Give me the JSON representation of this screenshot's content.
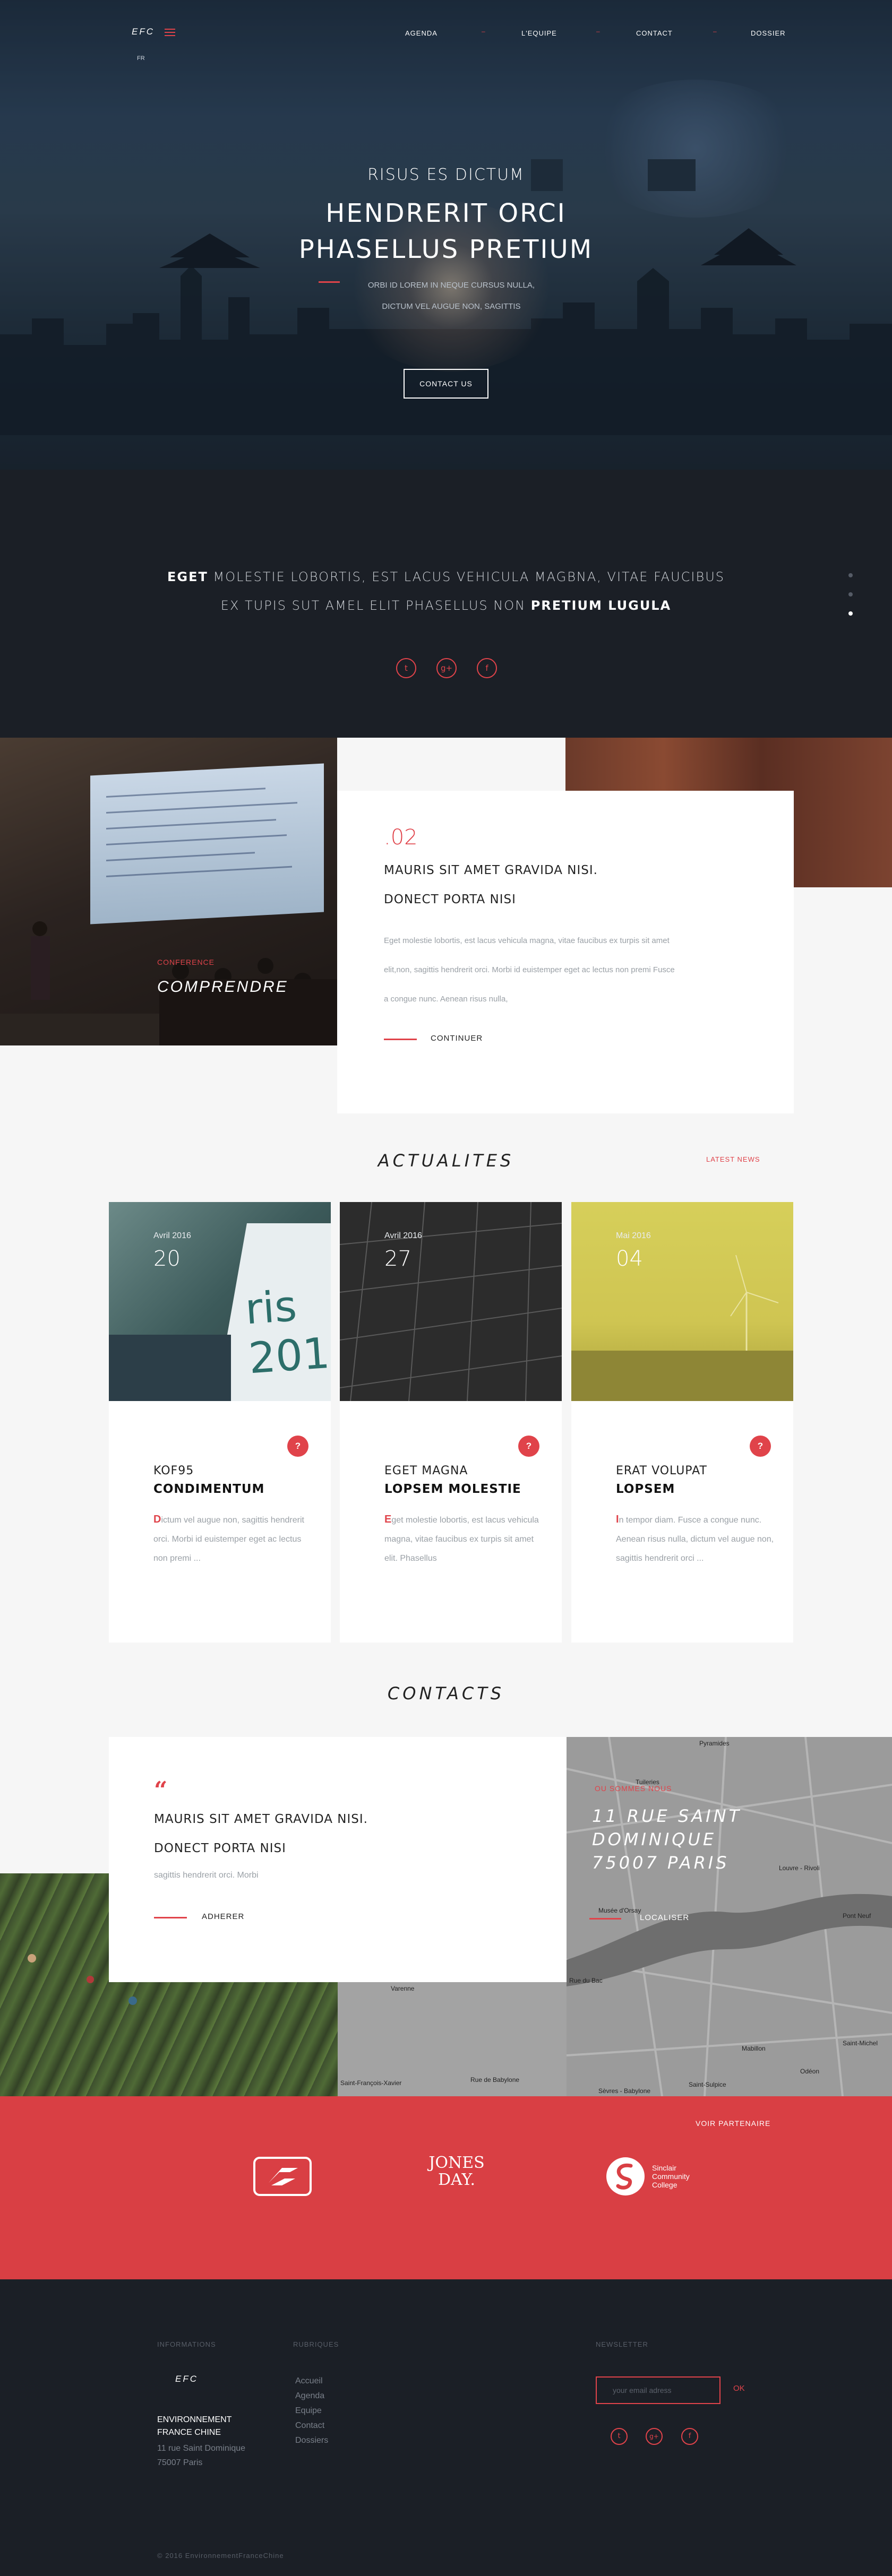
{
  "header": {
    "brand": "EFC",
    "lang": "FR",
    "nav": [
      "AGENDA",
      "L'EQUIPE",
      "CONTACT",
      "DOSSIER"
    ],
    "nav_sep": "–"
  },
  "hero": {
    "kicker": "RISUS ES DICTUM",
    "title_line1": "HENDRERIT ORCI",
    "title_line2": "PHASELLUS PRETIUM",
    "sub_line1": "ORBI ID LOREM IN NEQUE CURSUS NULLA,",
    "sub_line2": "DICTUM VEL AUGUE NON, SAGITTIS",
    "button": "CONTACT US"
  },
  "intro": {
    "line1_bold": "EGET",
    "line1_rest": " MOLESTIE LOBORTIS, EST LACUS VEHICULA MAGBNA, VITAE FAUCIBUS",
    "line2_rest": "EX TUPIS SUT AMEL ELIT PHASELLUS NON ",
    "line2_bold": "PRETIUM LUGULA",
    "social": [
      "twitter-icon",
      "google-plus-icon",
      "facebook-icon"
    ],
    "social_glyphs": [
      "t",
      "g+",
      "f"
    ]
  },
  "conference": {
    "label": "CONFERENCE",
    "title": "COMPRENDRE",
    "number": ".02",
    "heading1": "MAURIS SIT AMET GRAVIDA NISI.",
    "heading2": "DONECT PORTA NISI",
    "text_line1": "Eget molestie lobortis, est lacus vehicula magna, vitae faucibus ex turpis sit amet",
    "text_line2": "elit,non, sagittis hendrerit orci. Morbi id euistemper eget ac lectus non premi Fusce",
    "text_line3": "a congue nunc. Aenean risus nulla,",
    "link": "CONTINUER"
  },
  "news": {
    "title": "ACTUALITES",
    "latest": "LATEST NEWS",
    "items": [
      {
        "month": "Avril 2016",
        "day": "20",
        "badge": "?",
        "title1": "KOF95",
        "title2": "CONDIMENTUM",
        "initial": "D",
        "text": "ictum vel augue non, sagittis hendrerit orci. Morbi id euistemper eget ac lectus non premi ..."
      },
      {
        "month": "Avril 2016",
        "day": "27",
        "badge": "?",
        "title1": "EGET MAGNA",
        "title2": "LOPSEM MOLESTIE",
        "initial": "E",
        "text": "get molestie lobortis, est lacus vehicula magna, vitae faucibus ex turpis sit amet elit. Phasellus"
      },
      {
        "month": "Mai 2016",
        "day": "04",
        "badge": "?",
        "title1": "ERAT VOLUPAT",
        "title2": "LOPSEM",
        "initial": "I",
        "text": "n tempor diam. Fusce a congue nunc. Aenean risus nulla, dictum vel augue non, sagittis hendrerit orci ..."
      }
    ]
  },
  "contacts": {
    "title": "CONTACTS",
    "quote": "“",
    "heading1": "MAURIS SIT AMET GRAVIDA NISI.",
    "heading2": "DONECT PORTA NISI",
    "text": "sagittis hendrerit orci. Morbi",
    "link": "ADHERER",
    "addr_label": "OU SOMMES NOUS",
    "addr_line1": "11 RUE SAINT",
    "addr_line2": "DOMINIQUE",
    "addr_line3": "75007 PARIS",
    "locate": "LOCALISER",
    "map_labels": [
      "Pyramides",
      "Tuileries",
      "Louvre - Rivoli",
      "Pont Neuf",
      "Musée d'Orsay",
      "Rue du Bac",
      "Mabillon",
      "Odéon",
      "Saint-Michel",
      "Sèvres - Babylone",
      "Saint-Sulpice",
      "Saint-François-Xavier",
      "Varenne",
      "Rue de Babylone"
    ]
  },
  "partners": {
    "voir": "VOIR PARTENAIRE",
    "logo2": "JONES DAY.",
    "logo3_line1": "Sinclair",
    "logo3_line2": "Community",
    "logo3_line3": "College"
  },
  "footer": {
    "col1_head": "INFORMATIONS",
    "brand": "EFC",
    "company_line1": "ENVIRONNEMENT",
    "company_line2": "FRANCE CHINE",
    "addr_line1": "11 rue Saint Dominique",
    "addr_line2": "75007 Paris",
    "col2_head": "RUBRIQUES",
    "links": [
      "Accueil",
      "Agenda",
      "Equipe",
      "Contact",
      "Dossiers"
    ],
    "col3_head": "NEWSLETTER",
    "email_placeholder": "your email adress",
    "ok": "OK",
    "copyright": "© 2016 EnvironnementFranceChine"
  },
  "colors": {
    "accent": "#e0434a",
    "dark": "#1b1f26",
    "partners_bg": "#d93f44"
  }
}
